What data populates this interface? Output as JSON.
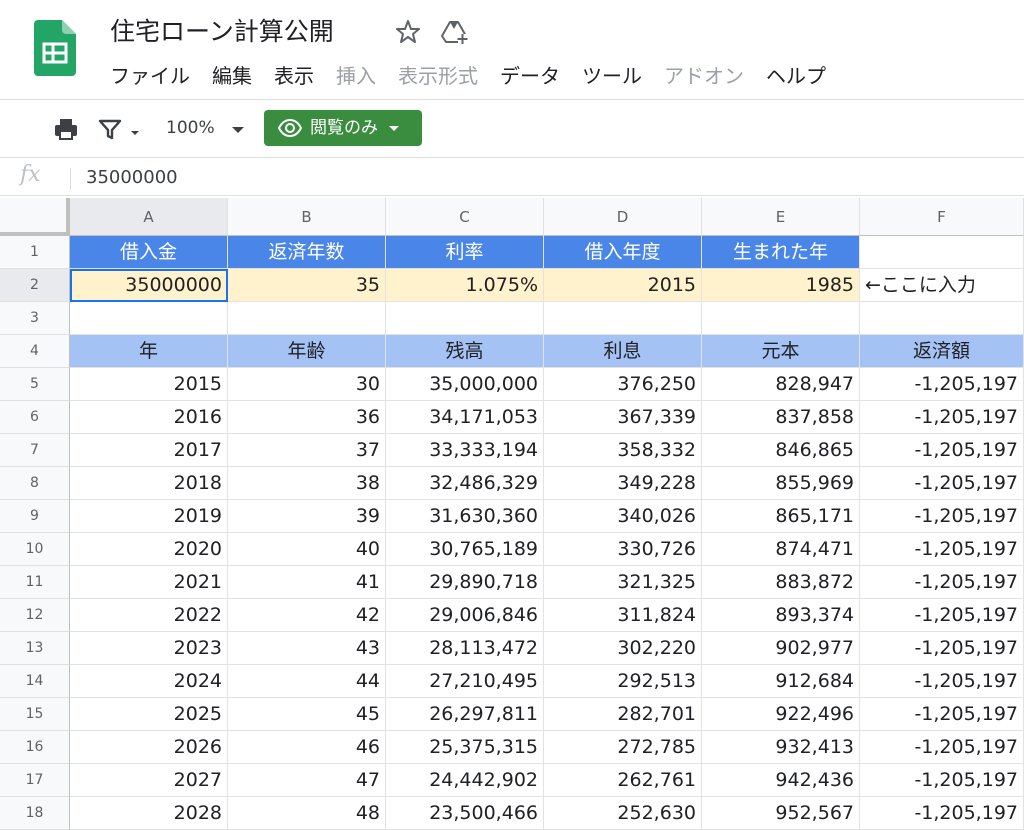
{
  "app": {
    "title": "住宅ローン計算公開",
    "menu": [
      {
        "label": "ファイル",
        "disabled": false
      },
      {
        "label": "編集",
        "disabled": false
      },
      {
        "label": "表示",
        "disabled": false
      },
      {
        "label": "挿入",
        "disabled": true
      },
      {
        "label": "表示形式",
        "disabled": true
      },
      {
        "label": "データ",
        "disabled": false
      },
      {
        "label": "ツール",
        "disabled": false
      },
      {
        "label": "アドオン",
        "disabled": true
      },
      {
        "label": "ヘルプ",
        "disabled": false
      }
    ]
  },
  "toolbar": {
    "zoom": "100%",
    "view_mode_label": "閲覧のみ",
    "view_mode_color": "#3a8d3f"
  },
  "formula_bar": {
    "fx_label": "fx",
    "value": "35000000"
  },
  "columns": [
    "A",
    "B",
    "C",
    "D",
    "E",
    "F"
  ],
  "row_numbers": [
    "1",
    "2",
    "3",
    "4",
    "5",
    "6",
    "7",
    "8",
    "9",
    "10",
    "11",
    "12",
    "13",
    "14",
    "15",
    "16",
    "17",
    "18"
  ],
  "inputs": {
    "headers": [
      "借入金",
      "返済年数",
      "利率",
      "借入年度",
      "生まれた年"
    ],
    "values": [
      "35000000",
      "35",
      "1.075%",
      "2015",
      "1985"
    ],
    "note": "←ここに入力"
  },
  "table": {
    "headers": [
      "年",
      "年齢",
      "残高",
      "利息",
      "元本",
      "返済額"
    ],
    "rows": [
      [
        "2015",
        "30",
        "35,000,000",
        "376,250",
        "828,947",
        "-1,205,197"
      ],
      [
        "2016",
        "36",
        "34,171,053",
        "367,339",
        "837,858",
        "-1,205,197"
      ],
      [
        "2017",
        "37",
        "33,333,194",
        "358,332",
        "846,865",
        "-1,205,197"
      ],
      [
        "2018",
        "38",
        "32,486,329",
        "349,228",
        "855,969",
        "-1,205,197"
      ],
      [
        "2019",
        "39",
        "31,630,360",
        "340,026",
        "865,171",
        "-1,205,197"
      ],
      [
        "2020",
        "40",
        "30,765,189",
        "330,726",
        "874,471",
        "-1,205,197"
      ],
      [
        "2021",
        "41",
        "29,890,718",
        "321,325",
        "883,872",
        "-1,205,197"
      ],
      [
        "2022",
        "42",
        "29,006,846",
        "311,824",
        "893,374",
        "-1,205,197"
      ],
      [
        "2023",
        "43",
        "28,113,472",
        "302,220",
        "902,977",
        "-1,205,197"
      ],
      [
        "2024",
        "44",
        "27,210,495",
        "292,513",
        "912,684",
        "-1,205,197"
      ],
      [
        "2025",
        "45",
        "26,297,811",
        "282,701",
        "922,496",
        "-1,205,197"
      ],
      [
        "2026",
        "46",
        "25,375,315",
        "272,785",
        "932,413",
        "-1,205,197"
      ],
      [
        "2027",
        "47",
        "24,442,902",
        "262,761",
        "942,436",
        "-1,205,197"
      ],
      [
        "2028",
        "48",
        "23,500,466",
        "252,630",
        "952,567",
        "-1,205,197"
      ]
    ]
  },
  "colors": {
    "header_blue": "#4a86e8",
    "input_yellow": "#fff2cc",
    "table_header_blue": "#a4c2f4",
    "sheets_green": "#23a566"
  }
}
